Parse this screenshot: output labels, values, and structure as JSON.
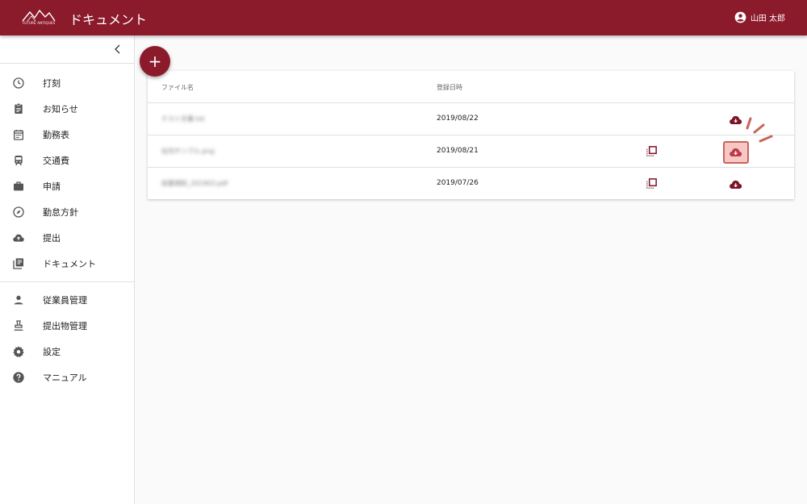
{
  "header": {
    "logo_text": "FUTURE ANTIQUES",
    "title": "ドキュメント",
    "user_name": "山田 太郎"
  },
  "sidebar": {
    "items": [
      {
        "label": "打刻",
        "icon": "clock-icon"
      },
      {
        "label": "お知らせ",
        "icon": "clipboard-icon"
      },
      {
        "label": "勤務表",
        "icon": "calendar-icon"
      },
      {
        "label": "交通費",
        "icon": "train-icon"
      },
      {
        "label": "申請",
        "icon": "briefcase-icon"
      },
      {
        "label": "勤怠方針",
        "icon": "compass-icon"
      },
      {
        "label": "提出",
        "icon": "cloud-upload-icon"
      },
      {
        "label": "ドキュメント",
        "icon": "library-books-icon"
      }
    ],
    "admin_items": [
      {
        "label": "従業員管理",
        "icon": "person-icon"
      },
      {
        "label": "提出物管理",
        "icon": "stamp-icon"
      },
      {
        "label": "設定",
        "icon": "gear-icon"
      },
      {
        "label": "マニュアル",
        "icon": "help-icon"
      }
    ]
  },
  "fab_label": "+",
  "table": {
    "headers": {
      "file_name": "ファイル名",
      "registered_at": "登録日時"
    },
    "rows": [
      {
        "file_name": "テスト文書.txt",
        "date": "2019/08/22",
        "has_copy": false,
        "highlighted": false
      },
      {
        "file_name": "社内サンプル.png",
        "date": "2019/08/21",
        "has_copy": true,
        "highlighted": true
      },
      {
        "file_name": "就業規則_201903.pdf",
        "date": "2019/07/26",
        "has_copy": true,
        "highlighted": false
      }
    ]
  },
  "colors": {
    "brand": "#8b1a2b",
    "highlight": "#f6c7c4",
    "highlight_border": "#c9645a"
  }
}
